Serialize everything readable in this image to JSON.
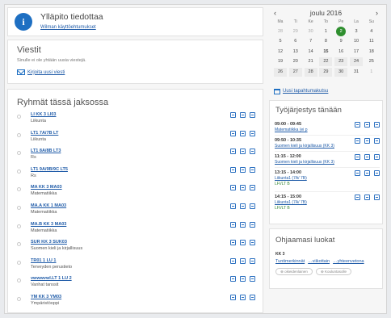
{
  "notice": {
    "title": "Ylläpito tiedottaa",
    "link": "Wilman käyttöehtumukset"
  },
  "messages": {
    "title": "Viestit",
    "status": "Sinulle ei ole yhtään uusia viestejä.",
    "write_link": "Kirjoita uusi viesti"
  },
  "groups": {
    "title": "Ryhmät tässä jaksossa",
    "items": [
      {
        "code": "LI KK 3 LI03",
        "subject": "Liikunta"
      },
      {
        "code": "LT1 7A/7B LT",
        "subject": "Liikunta"
      },
      {
        "code": "LT1 8A/8B LT3",
        "subject": "Rs"
      },
      {
        "code": "LT1 9A/9B/9C LT5",
        "subject": "Rs"
      },
      {
        "code": "MA KK 3 MA03",
        "subject": "Matematiikka"
      },
      {
        "code": "MA.A KK 1 MA03",
        "subject": "Matematiikka"
      },
      {
        "code": "MA.B KK 3 MA03",
        "subject": "Matematiikka"
      },
      {
        "code": "SUR KK 3 SUK03",
        "subject": "Suomen kieli ja kirjallisuus"
      },
      {
        "code": "TR01 1 LU 1",
        "subject": "Terveyden perustieto"
      },
      {
        "code": "vwwwvwl.LT 1 LU 2",
        "subject": "Vanhat tanssit"
      },
      {
        "code": "YM KK 3 YM03",
        "subject": "Ympäristöoppi"
      }
    ]
  },
  "calendar": {
    "prev": "‹",
    "next": "›",
    "month_label": "joulu  2016",
    "weekdays": [
      "Ma",
      "Ti",
      "Ke",
      "To",
      "Pe",
      "La",
      "Su"
    ],
    "days": [
      {
        "d": "28",
        "o": true
      },
      {
        "d": "29",
        "o": true
      },
      {
        "d": "30",
        "o": true
      },
      {
        "d": "1"
      },
      {
        "d": "2",
        "today": true
      },
      {
        "d": "3"
      },
      {
        "d": "4"
      },
      {
        "d": "5"
      },
      {
        "d": "6"
      },
      {
        "d": "7"
      },
      {
        "d": "8"
      },
      {
        "d": "9"
      },
      {
        "d": "10"
      },
      {
        "d": "11"
      },
      {
        "d": "12"
      },
      {
        "d": "13"
      },
      {
        "d": "14"
      },
      {
        "d": "15",
        "b": true
      },
      {
        "d": "16"
      },
      {
        "d": "17"
      },
      {
        "d": "18"
      },
      {
        "d": "19"
      },
      {
        "d": "20"
      },
      {
        "d": "21"
      },
      {
        "d": "22",
        "sh": true
      },
      {
        "d": "23",
        "sh": true
      },
      {
        "d": "24",
        "sh": true
      },
      {
        "d": "25"
      },
      {
        "d": "26",
        "sh": true
      },
      {
        "d": "27",
        "sh": true
      },
      {
        "d": "28",
        "sh": true
      },
      {
        "d": "29",
        "sh": true
      },
      {
        "d": "30",
        "sh": true
      },
      {
        "d": "31"
      },
      {
        "d": "1",
        "o": true
      }
    ],
    "new_event": "Uusi tapahtumakutsu"
  },
  "schedule": {
    "title": "Työjärjestys tänään",
    "lessons": [
      {
        "time": "09:00 - 09:45",
        "subject": "Matematiikka (ei p",
        "room": ""
      },
      {
        "time": "09:50 - 10:35",
        "subject": "Suomen kieli ja kirjallisuus (KK 3)",
        "room": ""
      },
      {
        "time": "11:15 - 12:00",
        "subject": "Suomen kieli ja kirjallisuus (KK 3)",
        "room": ""
      },
      {
        "time": "13:15 - 14:00",
        "subject": "Liikunta1 (7A/ 7B)",
        "room": "LFI/LT B"
      },
      {
        "time": "14:15 - 15:00",
        "subject": "Liikunta1 (7A/ 7B)",
        "room": "LFI/LT B"
      }
    ]
  },
  "guided": {
    "title": "Ohjaamasi luokat",
    "class": "KK 3",
    "links": [
      "Tuntimerkinnät",
      "…viikottain",
      "…yhteenvetona"
    ],
    "pills": [
      "⊕ oikeidenlainen",
      "⊕ Kouluntasolle"
    ]
  }
}
